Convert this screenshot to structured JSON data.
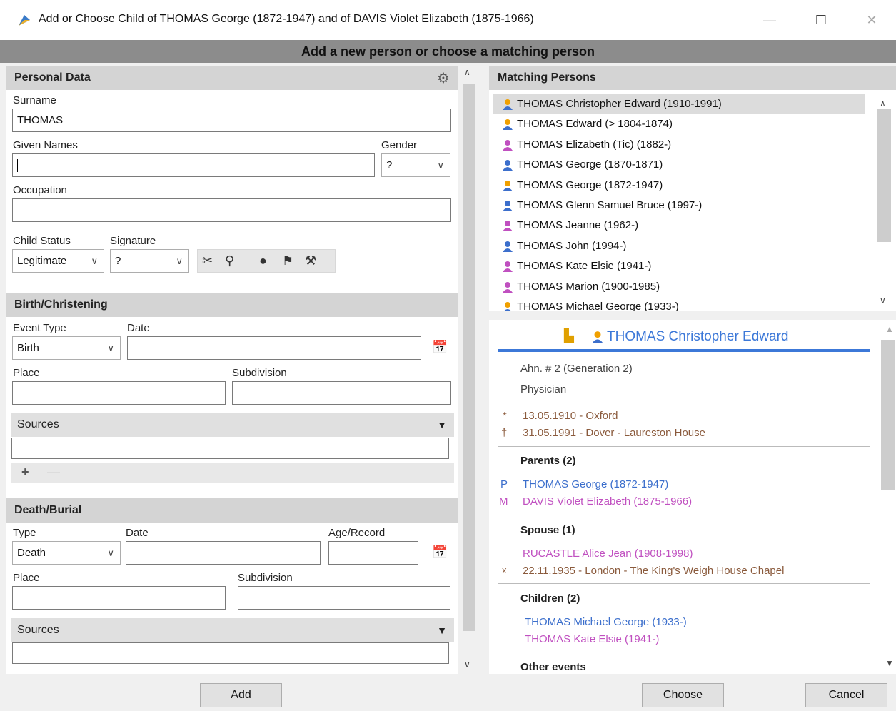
{
  "window": {
    "title": "Add or Choose Child of THOMAS George (1872-1947) and of DAVIS Violet Elizabeth (1875-1966)",
    "minimize": "—",
    "maximize": "☐",
    "close": "✕"
  },
  "banner": "Add a new person or choose a matching person",
  "personal": {
    "header": "Personal Data",
    "surname_label": "Surname",
    "surname_value": "THOMAS",
    "given_label": "Given Names",
    "given_value": "",
    "gender_label": "Gender",
    "gender_value": "?",
    "occupation_label": "Occupation",
    "occupation_value": "",
    "child_status_label": "Child Status",
    "child_status_value": "Legitimate",
    "signature_label": "Signature",
    "signature_value": "?"
  },
  "birth": {
    "header": "Birth/Christening",
    "event_type_label": "Event Type",
    "event_type_value": "Birth",
    "date_label": "Date",
    "date_value": "",
    "place_label": "Place",
    "place_value": "",
    "subdivision_label": "Subdivision",
    "subdivision_value": "",
    "sources_label": "Sources"
  },
  "death": {
    "header": "Death/Burial",
    "type_label": "Type",
    "type_value": "Death",
    "date_label": "Date",
    "age_label": "Age/Record",
    "place_label": "Place",
    "subdivision_label": "Subdivision",
    "sources_label": "Sources"
  },
  "matching": {
    "header": "Matching Persons",
    "persons": [
      {
        "name": "THOMAS Christopher Edward (1910-1991)",
        "sex": "male-selected"
      },
      {
        "name": "THOMAS Edward (> 1804-1874)",
        "sex": "male-orange"
      },
      {
        "name": "THOMAS Elizabeth (Tic) (1882-)",
        "sex": "female"
      },
      {
        "name": "THOMAS George (1870-1871)",
        "sex": "male"
      },
      {
        "name": "THOMAS George (1872-1947)",
        "sex": "male-orange"
      },
      {
        "name": "THOMAS Glenn Samuel Bruce (1997-)",
        "sex": "male"
      },
      {
        "name": "THOMAS Jeanne (1962-)",
        "sex": "female"
      },
      {
        "name": "THOMAS John (1994-)",
        "sex": "male"
      },
      {
        "name": "THOMAS Kate Elsie (1941-)",
        "sex": "female"
      },
      {
        "name": "THOMAS Marion (1900-1985)",
        "sex": "female"
      },
      {
        "name": "THOMAS Michael George (1933-)",
        "sex": "male-orange"
      }
    ]
  },
  "detail": {
    "name": "THOMAS Christopher Edward",
    "ahn": "Ahn. # 2 (Generation 2)",
    "occupation": "Physician",
    "birth_symbol": "*",
    "birth": "13.05.1910 - Oxford",
    "death_symbol": "†",
    "death": "31.05.1991 - Dover - Laureston House",
    "parents_header": "Parents (2)",
    "father_prefix": "P",
    "father": "THOMAS George (1872-1947)",
    "mother_prefix": "M",
    "mother": "DAVIS Violet Elizabeth (1875-1966)",
    "spouse_header": "Spouse (1)",
    "spouse": "RUCASTLE Alice Jean (1908-1998)",
    "marriage_prefix": "x",
    "marriage": "22.11.1935 - London - The King's Weigh House Chapel",
    "children_header": "Children (2)",
    "child1": "THOMAS Michael George (1933-)",
    "child2": "THOMAS Kate Elsie (1941-)",
    "other_header": "Other events"
  },
  "buttons": {
    "add": "Add",
    "choose": "Choose",
    "cancel": "Cancel"
  },
  "colors": {
    "male": "#3c6fcc",
    "female": "#c050c0",
    "orange": "#f0a000"
  }
}
